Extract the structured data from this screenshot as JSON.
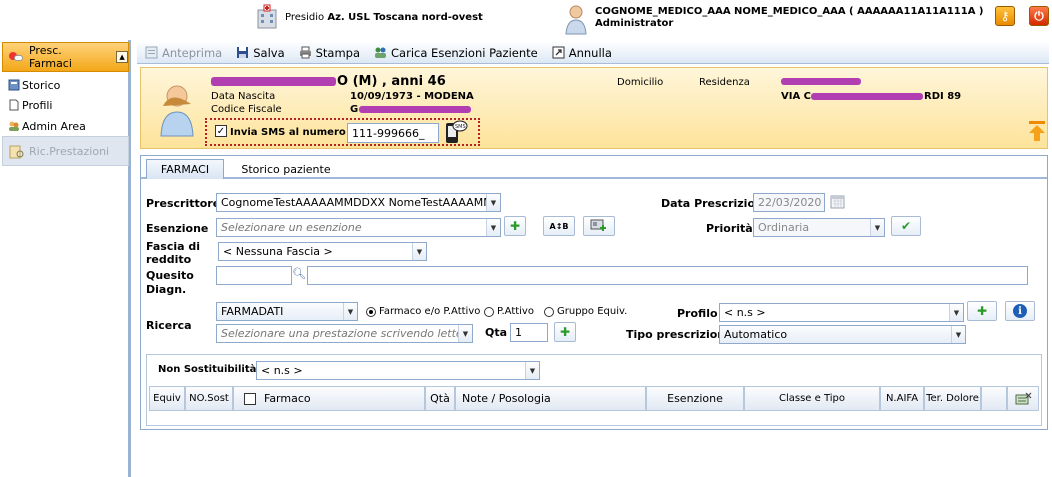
{
  "header": {
    "presidio_label": "Presidio",
    "presidio_name": "Az. USL Toscana nord-ovest",
    "user_name": "COGNOME_MEDICO_AAA NOME_MEDICO_AAA ( AAAAAA11A11A111A )",
    "user_role": "Administrator",
    "icons": [
      "hospital-icon",
      "user-icon",
      "key-icon",
      "power-icon"
    ]
  },
  "sidebar": {
    "section_title": "Presc. Farmaci",
    "items": [
      {
        "label": "Storico",
        "icon": "history-icon"
      },
      {
        "label": "Profili",
        "icon": "document-icon"
      },
      {
        "label": "Admin Area",
        "icon": "users-icon"
      }
    ],
    "ric_label": "Ric.Prestazioni"
  },
  "toolbar": {
    "anteprima": "Anteprima",
    "salva": "Salva",
    "stampa": "Stampa",
    "carica": "Carica Esenzioni Paziente",
    "annulla": "Annulla"
  },
  "patient": {
    "name_suffix": "O (M) , anni 46",
    "data_nascita_label": "Data Nascita",
    "data_nascita_value": "10/09/1973 - MODENA",
    "codice_fiscale_label": "Codice Fiscale",
    "codice_fiscale_value": "G",
    "domicilio_label": "Domicilio",
    "residenza_label": "Residenza",
    "residenza_value_start": "VIA C",
    "residenza_value_end": "RDI 89",
    "sms_label": "Invia SMS al numero",
    "sms_checked": true,
    "sms_number": "111-999666_"
  },
  "tabs": [
    "FARMACI",
    "Storico paziente"
  ],
  "form": {
    "prescrittore_label": "Prescrittore",
    "prescrittore_value": "CognomeTestAAAAAMMDDXX NomeTestAAAAMM",
    "data_prescrizioni_label": "Data Prescrizioni",
    "data_prescrizioni_value": "22/03/2020",
    "esenzione_label": "Esenzione",
    "esenzione_placeholder": "Selezionare un esenzione",
    "priorita_label": "Priorità",
    "priorita_value": "Ordinaria",
    "fascia_label_1": "Fascia di",
    "fascia_label_2": "reddito",
    "fascia_value": "< Nessuna Fascia >",
    "quesito_label_1": "Quesito",
    "quesito_label_2": "Diagn.",
    "ricerca_label": "Ricerca",
    "ricerca_source": "FARMADATI",
    "ricerca_options": [
      "Farmaco e/o P.Attivo",
      "P.Attivo",
      "Gruppo Equiv."
    ],
    "ricerca_selected": 0,
    "prestazione_placeholder": "Selezionare una prestazione scrivendo lettere",
    "qta_label": "Qta",
    "qta_value": "1",
    "profilo_label": "Profilo",
    "profilo_value": "< n.s >",
    "tipo_label": "Tipo prescrizione",
    "tipo_value": "Automatico"
  },
  "table": {
    "non_sost_label": "Non Sostituibilità:",
    "non_sost_value": "< n.s >",
    "columns": [
      "Equiv",
      "NO.Sost",
      "Farmaco",
      "Qtà",
      "Note / Posologia",
      "Esenzione",
      "Classe e Tipo",
      "N.AIFA",
      "Ter. Dolore"
    ]
  },
  "colors": {
    "accent_orange": "#f3a818",
    "patient_bg": "#fde39a",
    "border_blue": "#8ea9cb",
    "redaction": "#b23fb2"
  }
}
